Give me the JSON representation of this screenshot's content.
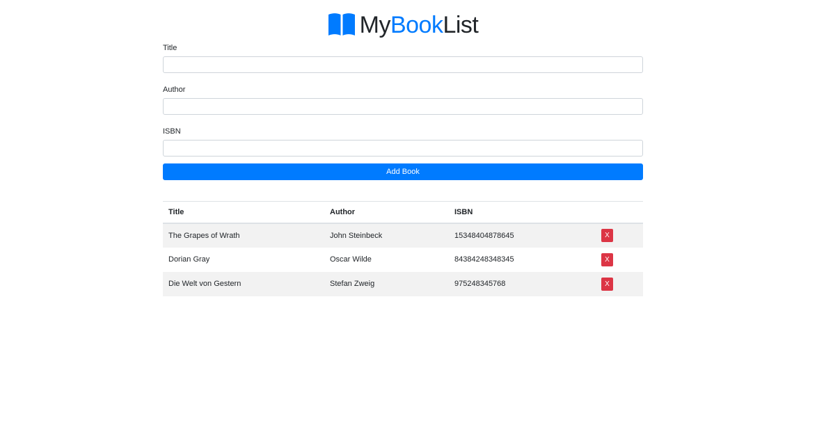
{
  "brand": {
    "my": "My",
    "book": "Book",
    "list": "List",
    "accent_color": "#007bff",
    "icon": "open-book-icon"
  },
  "form": {
    "title_label": "Title",
    "title_value": "",
    "author_label": "Author",
    "author_value": "",
    "isbn_label": "ISBN",
    "isbn_value": "",
    "submit_label": "Add Book",
    "submit_color": "#007bff"
  },
  "table": {
    "headers": [
      "Title",
      "Author",
      "ISBN",
      ""
    ],
    "rows": [
      {
        "title": "The Grapes of Wrath",
        "author": "John Steinbeck",
        "isbn": "15348404878645",
        "delete_label": "X"
      },
      {
        "title": "Dorian Gray",
        "author": "Oscar Wilde",
        "isbn": "84384248348345",
        "delete_label": "X"
      },
      {
        "title": "Die Welt von Gestern",
        "author": "Stefan Zweig",
        "isbn": "975248345768",
        "delete_label": "X"
      }
    ],
    "delete_color": "#dc3545"
  }
}
